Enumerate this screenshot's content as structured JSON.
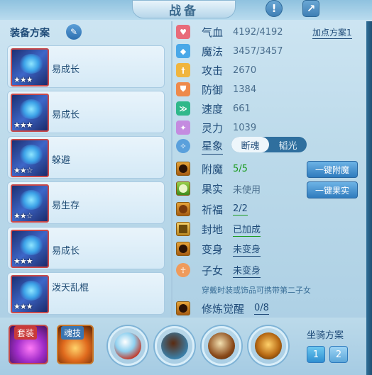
{
  "header": {
    "title": "战备"
  },
  "left": {
    "section_label": "装备方案",
    "cards": [
      {
        "label": "易成长",
        "stars": "★★★"
      },
      {
        "label": "易成长",
        "stars": "★★★"
      },
      {
        "label": "躲避",
        "stars": "★★☆"
      },
      {
        "label": "易生存",
        "stars": "★★☆"
      },
      {
        "label": "易成长",
        "stars": "★★★"
      },
      {
        "label": "泼天乱棍",
        "stars": "★★★"
      }
    ]
  },
  "stats": {
    "plan_link": "加点方案1",
    "rows": [
      {
        "name": "气血",
        "value": "4192/4192"
      },
      {
        "name": "魔法",
        "value": "3457/3457"
      },
      {
        "name": "攻击",
        "value": "2670"
      },
      {
        "name": "防御",
        "value": "1384"
      },
      {
        "name": "速度",
        "value": "661"
      },
      {
        "name": "灵力",
        "value": "1039"
      }
    ],
    "star_name": "星象",
    "toggle": {
      "options": [
        "断魂",
        "韬光"
      ],
      "selected": "断魂"
    }
  },
  "extras": {
    "rows": [
      {
        "name": "附魔",
        "value": "5/5"
      },
      {
        "name": "果实",
        "value": "未使用"
      },
      {
        "name": "祈福",
        "value": "2/2"
      },
      {
        "name": "封地",
        "value": "已加成"
      },
      {
        "name": "变身",
        "value": "未变身"
      },
      {
        "name": "子女",
        "value": "未变身"
      }
    ],
    "note": "穿戴时装或饰品可携带第二子女",
    "awaken": {
      "name": "修炼觉醒",
      "value": "0/8"
    },
    "btn_enchant": "一键附魔",
    "btn_fruit": "一键果实"
  },
  "bottom": {
    "suit_label": "套装",
    "soul_label": "魂技",
    "mount_label": "坐骑方案",
    "mount_buttons": [
      "1",
      "2"
    ]
  },
  "colors": {
    "accent": "#1f4b78",
    "green": "#1b9b20"
  }
}
